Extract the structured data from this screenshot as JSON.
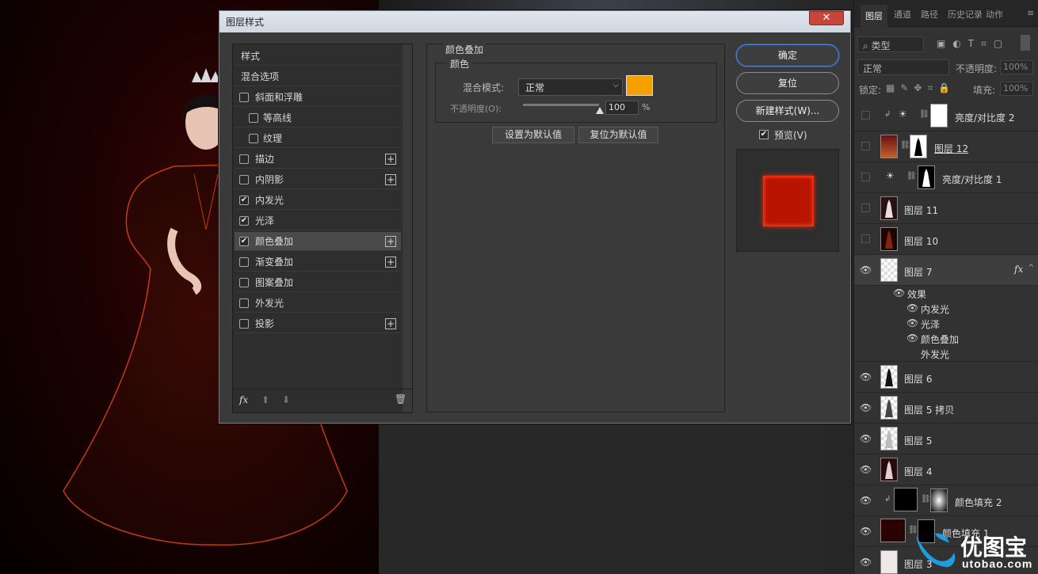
{
  "dialog": {
    "title": "图层样式",
    "close": "✕",
    "left_list": [
      {
        "label": "样式",
        "type": "header"
      },
      {
        "label": "混合选项",
        "type": "header"
      },
      {
        "label": "斜面和浮雕",
        "checked": false,
        "plus": false
      },
      {
        "label": "等高线",
        "checked": false,
        "plus": false,
        "sub": true
      },
      {
        "label": "纹理",
        "checked": false,
        "plus": false,
        "sub": true
      },
      {
        "label": "描边",
        "checked": false,
        "plus": true
      },
      {
        "label": "内阴影",
        "checked": false,
        "plus": true
      },
      {
        "label": "内发光",
        "checked": true,
        "plus": false
      },
      {
        "label": "光泽",
        "checked": true,
        "plus": false
      },
      {
        "label": "颜色叠加",
        "checked": true,
        "plus": true,
        "selected": true
      },
      {
        "label": "渐变叠加",
        "checked": false,
        "plus": true
      },
      {
        "label": "图案叠加",
        "checked": false,
        "plus": false
      },
      {
        "label": "外发光",
        "checked": false,
        "plus": false
      },
      {
        "label": "投影",
        "checked": false,
        "plus": true
      }
    ],
    "fx_label": "fx",
    "section_title": "颜色叠加",
    "group_title": "颜色",
    "blend_label": "混合模式:",
    "blend_value": "正常",
    "opacity_label": "不透明度(O):",
    "opacity_value": "100",
    "opacity_fraction": 1.0,
    "percent": "%",
    "overlay_color": "#f5a000",
    "set_default": "设置为默认值",
    "reset_default": "复位为默认值",
    "ok": "确定",
    "reset": "复位",
    "new_style": "新建样式(W)...",
    "preview_label": "预览(V)",
    "preview_checked": true
  },
  "panel": {
    "tabs": [
      "图层",
      "通道",
      "路径",
      "历史记录",
      "动作"
    ],
    "filter_label": "类型",
    "mode_value": "正常",
    "opacity_label": "不透明度:",
    "opacity_value": "100%",
    "lock_label": "锁定:",
    "fill_label": "填充:",
    "fill_value": "100%",
    "layers": [
      {
        "name": "亮度/对比度 2",
        "visible": false
      },
      {
        "name": "图层 12",
        "visible": false
      },
      {
        "name": "亮度/对比度 1",
        "visible": false
      },
      {
        "name": "图层 11",
        "visible": false
      },
      {
        "name": "图层 10",
        "visible": false
      },
      {
        "name": "图层 7",
        "visible": true,
        "fx": "fx"
      },
      {
        "name": "效果",
        "visible": true
      },
      {
        "name": "内发光",
        "visible": true
      },
      {
        "name": "光泽",
        "visible": true
      },
      {
        "name": "颜色叠加",
        "visible": true
      },
      {
        "name": "外发光",
        "visible": false
      },
      {
        "name": "图层 6",
        "visible": true
      },
      {
        "name": "图层 5 拷贝",
        "visible": true
      },
      {
        "name": "图层 5",
        "visible": true
      },
      {
        "name": "图层 4",
        "visible": true
      },
      {
        "name": "颜色填充 2",
        "visible": true
      },
      {
        "name": "颜色填充 1",
        "visible": true
      },
      {
        "name": "图层 3",
        "visible": true
      }
    ]
  },
  "watermark": {
    "text": "优图宝",
    "sub": "utobao.com"
  }
}
